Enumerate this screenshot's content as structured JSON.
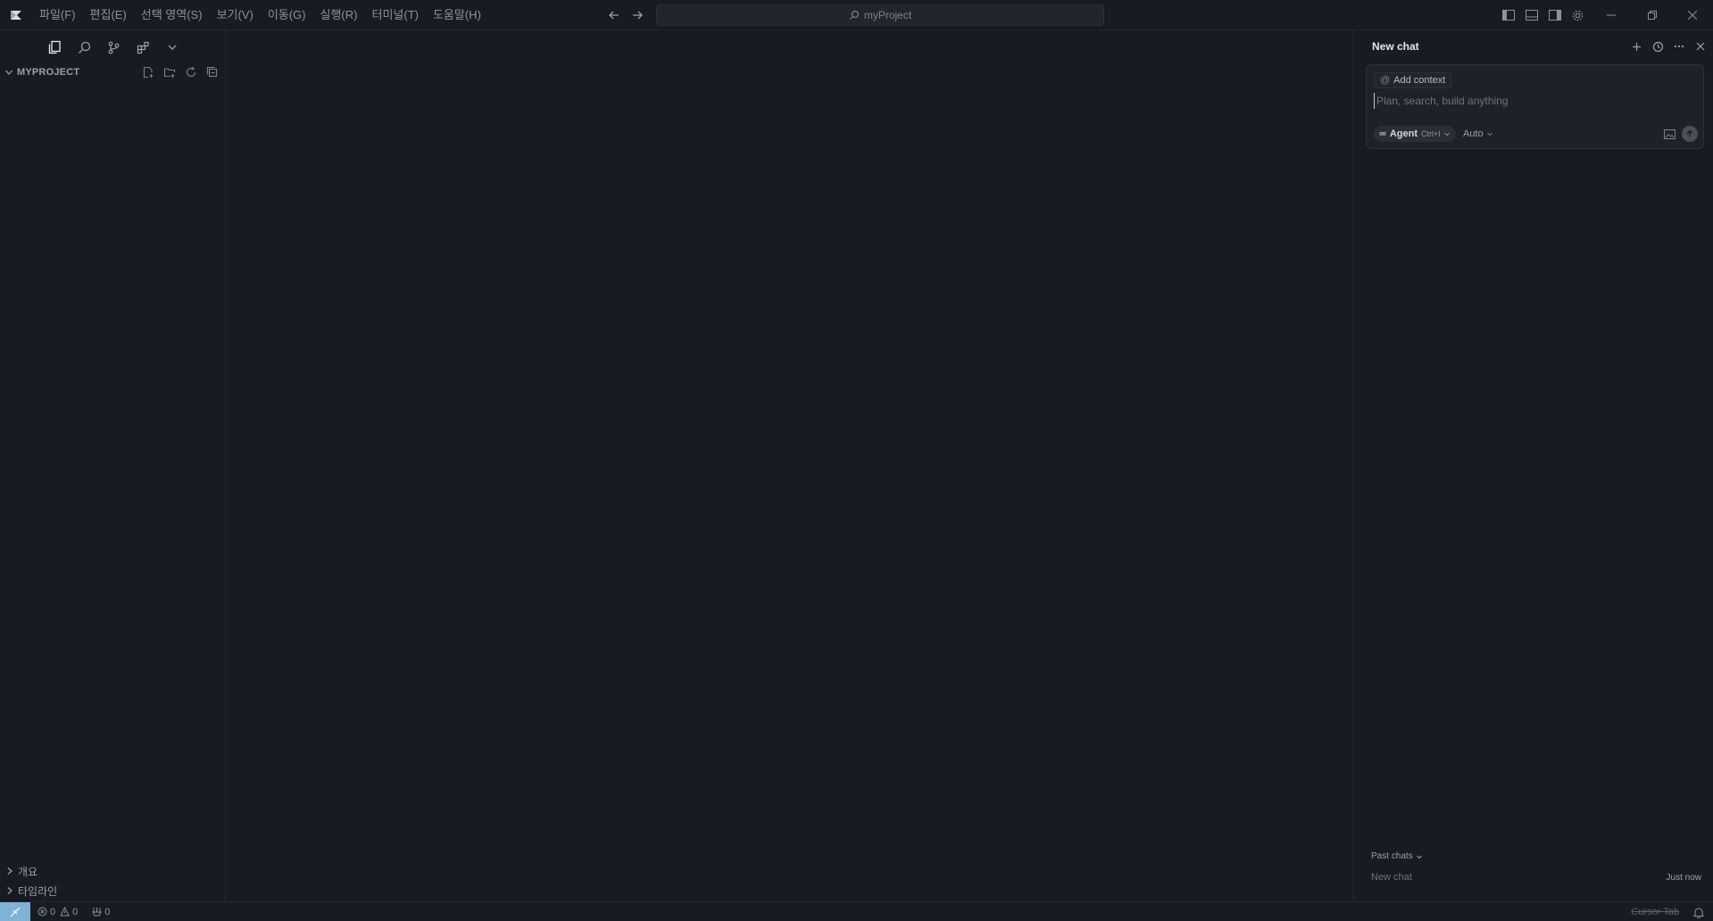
{
  "titlebar": {
    "menu": [
      "파일(F)",
      "편집(E)",
      "선택 영역(S)",
      "보기(V)",
      "이동(G)",
      "실행(R)",
      "터미널(T)",
      "도움말(H)"
    ],
    "search_label": "myProject"
  },
  "sidebar": {
    "explorer_title": "MYPROJECT",
    "bottom_sections": [
      "개요",
      "타임라인"
    ]
  },
  "chat": {
    "title": "New chat",
    "add_context_label": "Add context",
    "input_placeholder": "Plan, search, build anything",
    "mode_label": "Agent",
    "mode_shortcut": "Ctrl+I",
    "model_label": "Auto",
    "past_chats_label": "Past chats",
    "past_chats": [
      {
        "name": "New chat",
        "time": "Just now"
      }
    ]
  },
  "statusbar": {
    "errors": "0",
    "warnings": "0",
    "ports": "0",
    "cursor_tab": "Cursor Tab"
  },
  "colors": {
    "background": "#181b22",
    "remote_accent": "#7fb3d5"
  }
}
